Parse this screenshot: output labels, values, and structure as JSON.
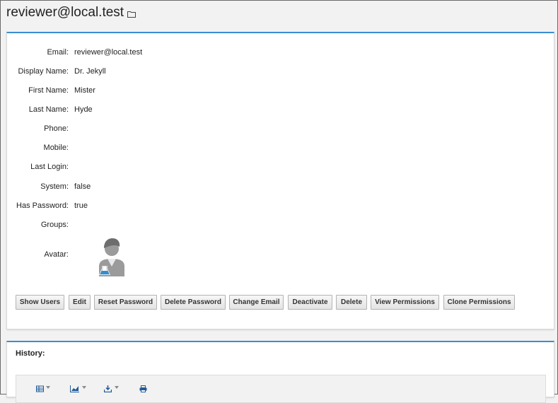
{
  "page": {
    "title": "reviewer@local.test"
  },
  "details": {
    "fields": [
      {
        "label": "Email:",
        "value": "reviewer@local.test"
      },
      {
        "label": "Display Name:",
        "value": "Dr. Jekyll"
      },
      {
        "label": "First Name:",
        "value": "Mister"
      },
      {
        "label": "Last Name:",
        "value": "Hyde"
      },
      {
        "label": "Phone:",
        "value": ""
      },
      {
        "label": "Mobile:",
        "value": ""
      },
      {
        "label": "Last Login:",
        "value": ""
      },
      {
        "label": "System:",
        "value": "false"
      },
      {
        "label": "Has Password:",
        "value": "true"
      },
      {
        "label": "Groups:",
        "value": ""
      }
    ],
    "avatar_label": "Avatar:",
    "buttons": [
      {
        "label": "Show Users"
      },
      {
        "label": "Edit"
      },
      {
        "label": "Reset Password"
      },
      {
        "label": "Delete Password"
      },
      {
        "label": "Change Email"
      },
      {
        "label": "Deactivate"
      },
      {
        "label": "Delete"
      },
      {
        "label": "View Permissions"
      },
      {
        "label": "Clone Permissions"
      }
    ]
  },
  "history": {
    "title": "History:",
    "toolbar_icons": [
      "grid-icon",
      "chart-icon",
      "export-icon",
      "print-icon"
    ]
  },
  "colors": {
    "accent": "#3a8dd1",
    "icon_blue": "#1e5a99",
    "avatar_flask": "#2f8fd6"
  }
}
